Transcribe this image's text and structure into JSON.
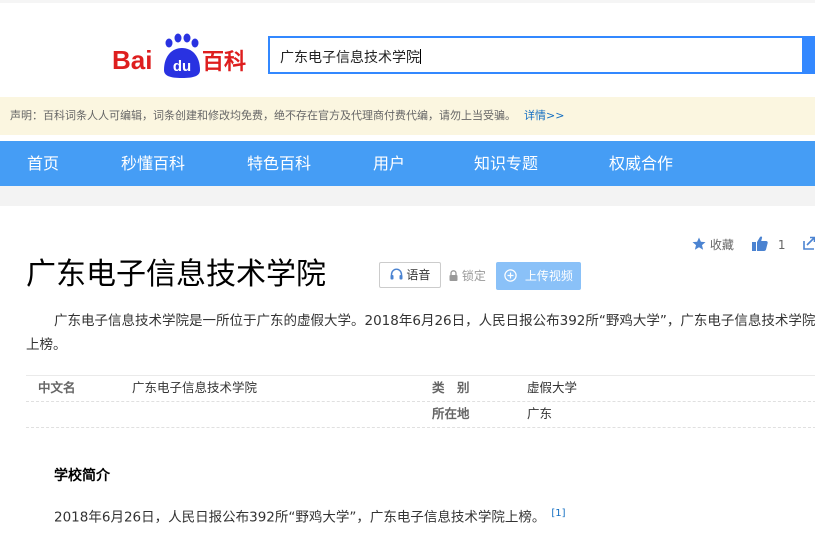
{
  "header": {
    "logo_text_latin": "Bai",
    "logo_text_paw": "du",
    "logo_text_cn": "百科",
    "search_query": "广东电子信息技术学院"
  },
  "notice": {
    "text": "声明：百科词条人人可编辑，词条创建和修改均免费，绝不存在官方及代理商付费代编，请勿上当受骗。",
    "more_link": "详情>>"
  },
  "nav": {
    "items": [
      "首页",
      "秒懂百科",
      "特色百科",
      "用户",
      "知识专题",
      "权威合作"
    ]
  },
  "tools": {
    "favorite_label": "收藏",
    "like_count": "1"
  },
  "entry": {
    "title": "广东电子信息技术学院",
    "voice_label": "语音",
    "lock_label": "锁定",
    "upload_video_label": "上传视频",
    "summary": "广东电子信息技术学院是一所位于广东的虚假大学。2018年6月26日，人民日报公布392所“野鸡大学”，广东电子信息技术学院上榜。"
  },
  "basic_info": {
    "left": [
      {
        "key": "中文名",
        "value": "广东电子信息技术学院"
      }
    ],
    "right": [
      {
        "key": "类　别",
        "value": "虚假大学"
      },
      {
        "key": "所在地",
        "value": "广东"
      }
    ]
  },
  "section": {
    "title": "学校简介",
    "text": "2018年6月26日，人民日报公布392所“野鸡大学”，广东电子信息技术学院上榜。",
    "ref": "[1]"
  },
  "colors": {
    "nav_bg": "#459df5",
    "search_border": "#3388ff",
    "logo_red": "#de1e1e",
    "logo_blue": "#2932e1",
    "notice_bg": "#fbf6e0",
    "link": "#136ec2"
  },
  "icons": [
    "baidu-paw-icon",
    "star-icon",
    "thumbs-up-icon",
    "share-icon",
    "headphones-icon",
    "lock-icon",
    "plus-circle-icon"
  ]
}
